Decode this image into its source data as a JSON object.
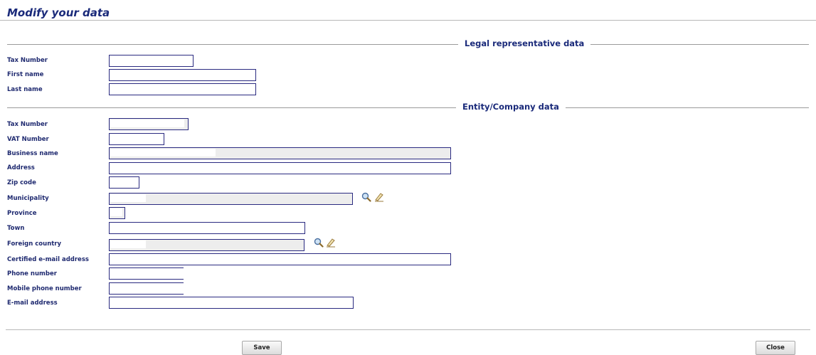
{
  "page": {
    "title": "Modify your data"
  },
  "legal": {
    "heading": "Legal representative data",
    "tax_number": {
      "label": "Tax Number",
      "value": ""
    },
    "first_name": {
      "label": "First name",
      "value": ""
    },
    "last_name": {
      "label": "Last name",
      "value": ""
    }
  },
  "company": {
    "heading": "Entity/Company data",
    "tax_number": {
      "label": "Tax Number",
      "value": ""
    },
    "vat_number": {
      "label": "VAT Number",
      "value": ""
    },
    "business_name": {
      "label": "Business name",
      "value": ""
    },
    "address": {
      "label": "Address",
      "value": ""
    },
    "zip_code": {
      "label": "Zip code",
      "value": ""
    },
    "municipality": {
      "label": "Municipality",
      "value": "",
      "icons": [
        "search-icon",
        "eraser-icon"
      ]
    },
    "province": {
      "label": "Province",
      "value": ""
    },
    "town": {
      "label": "Town",
      "value": ""
    },
    "foreign_country": {
      "label": "Foreign country",
      "value": "",
      "icons": [
        "search-icon",
        "eraser-icon"
      ]
    },
    "pec": {
      "label": "Certified e-mail address",
      "value": ""
    },
    "phone": {
      "label": "Phone number",
      "value": ""
    },
    "mobile": {
      "label": "Mobile phone number",
      "value": ""
    },
    "email": {
      "label": "E-mail address",
      "value": ""
    }
  },
  "buttons": {
    "save": "Save",
    "close": "Close"
  },
  "colors": {
    "label": "#1f2a70",
    "field_border": "#2a2a80",
    "readonly_bg": "#ededed"
  }
}
